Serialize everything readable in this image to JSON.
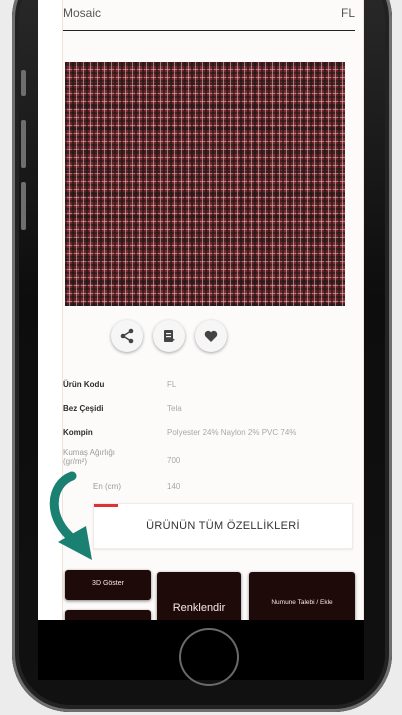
{
  "dropdown": {
    "value": "Mosaic",
    "code": "FL"
  },
  "actions": {
    "share_icon": "share-icon",
    "catalog_icon": "catalog-icon",
    "favorite_icon": "heart-icon"
  },
  "specs": [
    {
      "label": "Ürün Kodu",
      "value": "FL"
    },
    {
      "label": "Bez Çeşidi",
      "value": "Tela"
    },
    {
      "label": "Kompin",
      "value": "Polyester 24% Naylon 2% PVC 74%"
    },
    {
      "label": "Kumaş Ağırlığı (gr/m²)",
      "value": "700"
    },
    {
      "label": "En (cm)",
      "value": "140"
    }
  ],
  "buttons": {
    "all_features": "ÜRÜNÜN TÜM ÖZELLİKLERİ",
    "view_3d": "3D Göster",
    "colorize": "Renklendir",
    "sample_request": "Numune Talebi / Ekle"
  },
  "colors": {
    "accent_dark": "#1f0a0a",
    "arrow": "#1a8072",
    "accent_red": "#d33333"
  }
}
